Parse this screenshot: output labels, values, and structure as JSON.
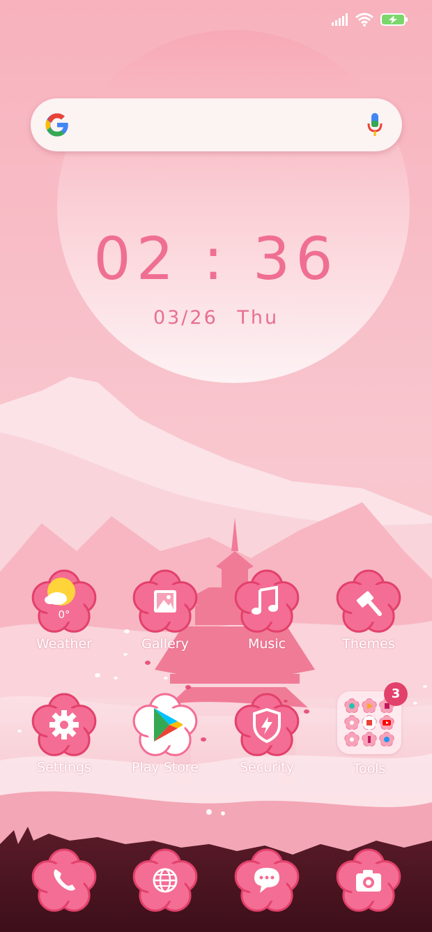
{
  "clock": {
    "time": "02 : 36",
    "date": "03/26",
    "day": "Thu"
  },
  "search": {
    "logo": "google-logo",
    "mic": "microphone-icon"
  },
  "status_bar": {
    "signal": "signal-icon",
    "wifi": "wifi-icon",
    "battery": "battery-charging-icon"
  },
  "apps_row1": [
    {
      "label": "Weather",
      "icon": "weather-icon",
      "temp": "0°"
    },
    {
      "label": "Gallery",
      "icon": "gallery-icon"
    },
    {
      "label": "Music",
      "icon": "music-icon"
    },
    {
      "label": "Themes",
      "icon": "themes-icon"
    }
  ],
  "apps_row2": [
    {
      "label": "Settings",
      "icon": "gear-icon"
    },
    {
      "label": "Play Store",
      "icon": "play-store-icon"
    },
    {
      "label": "Security",
      "icon": "security-icon"
    },
    {
      "label": "Tools",
      "icon": "folder-icon",
      "badge": "3"
    }
  ],
  "dock": [
    {
      "icon": "phone-icon"
    },
    {
      "icon": "browser-icon"
    },
    {
      "icon": "messages-icon"
    },
    {
      "icon": "camera-icon"
    }
  ],
  "colors": {
    "accent": "#ef6f92",
    "petal": "#f46d94",
    "petal_dark": "#e2416b",
    "sky": "#f6b8c2"
  }
}
